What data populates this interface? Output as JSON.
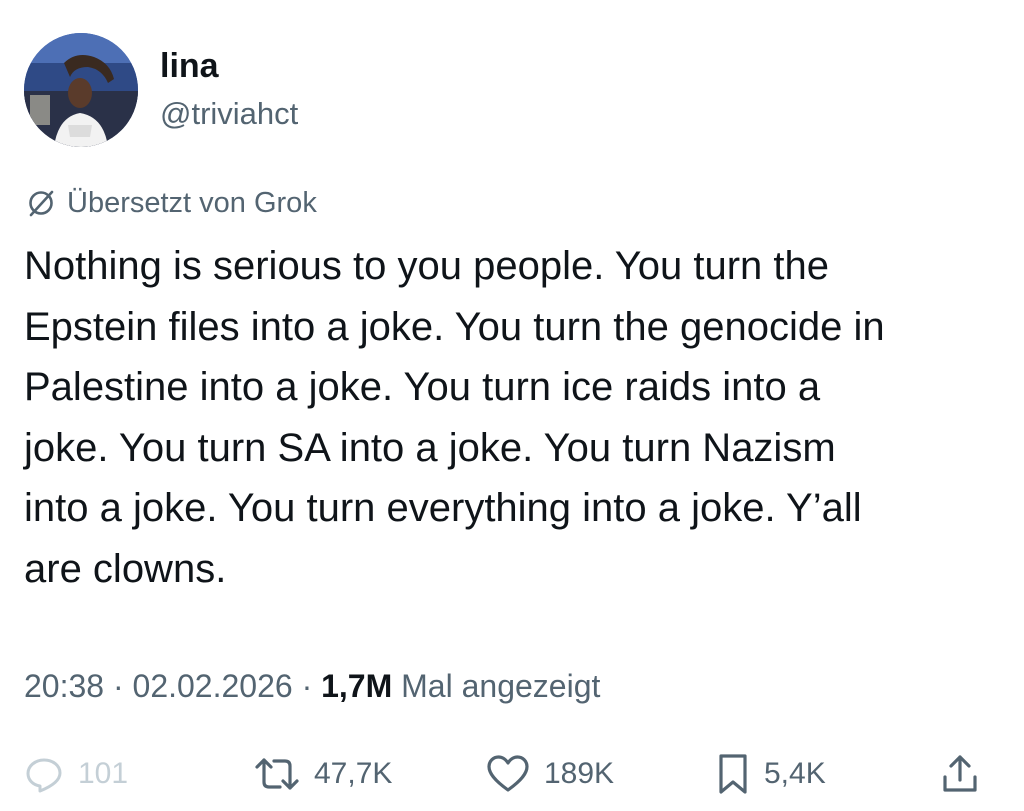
{
  "author": {
    "display_name": "lina",
    "handle": "@triviahct",
    "avatar_icon": "profile-photo"
  },
  "translation_note": {
    "icon": "translate-globe-icon",
    "label": "Übersetzt von Grok"
  },
  "tweet": {
    "text": "Nothing is serious to you people. You turn the\nEpstein files into a joke. You turn the genocide in\nPalestine into a joke. You turn ice raids into a\njoke. You turn SA into a joke. You turn Nazism\ninto a joke. You turn everything into a joke. Y’all\nare clowns."
  },
  "meta": {
    "time": "20:38",
    "separator": " · ",
    "date": "02.02.2026",
    "views_count": "1,7M",
    "views_label": "Mal angezeigt"
  },
  "actions": {
    "replies": "101",
    "retweets": "47,7K",
    "likes": "189K",
    "bookmarks": "5,4K"
  },
  "colors": {
    "text_primary": "#0f1419",
    "text_secondary": "#536471",
    "disabled": "#c4cfd6",
    "background": "#ffffff"
  }
}
